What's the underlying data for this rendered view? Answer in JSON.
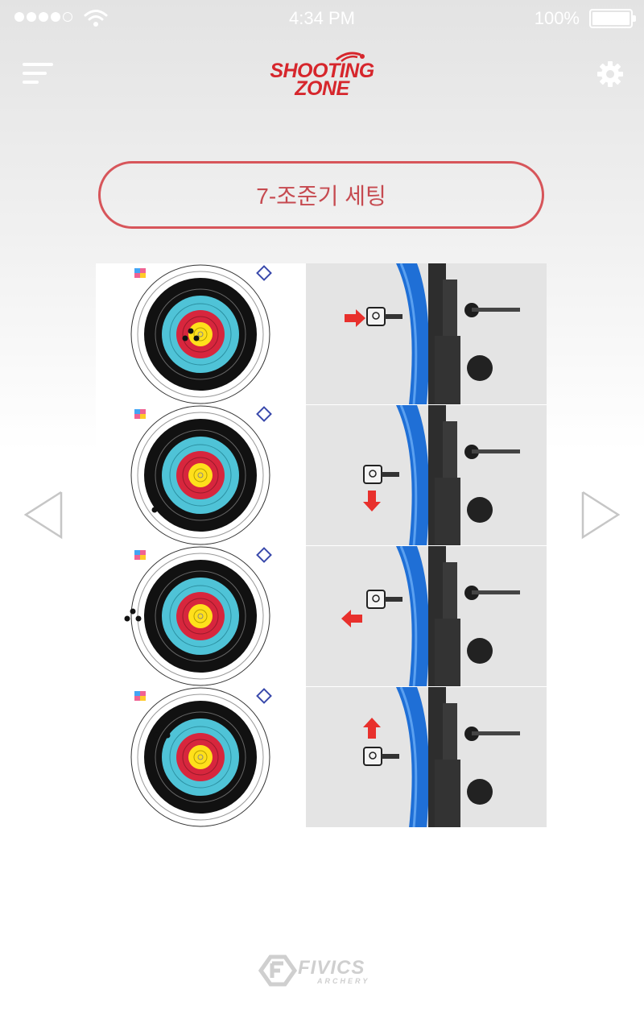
{
  "status_bar": {
    "time": "4:34 PM",
    "battery_percent": "100%",
    "signal_bars_filled": 4,
    "signal_bars_total": 5
  },
  "header": {
    "app_logo_line1": "SHOOTING",
    "app_logo_line2": "ZONE",
    "menu_icon": "menu-icon",
    "settings_icon": "gear-icon"
  },
  "page": {
    "title": "7-조준기 세팅"
  },
  "steps": [
    {
      "target_group": "right",
      "arrow": "right"
    },
    {
      "target_group": "bottom",
      "arrow": "down"
    },
    {
      "target_group": "left",
      "arrow": "left"
    },
    {
      "target_group": "top",
      "arrow": "up"
    }
  ],
  "navigation": {
    "prev_icon": "chevron-left-icon",
    "next_icon": "chevron-right-icon"
  },
  "footer": {
    "brand": "FIVICS",
    "brand_sub": "ARCHERY"
  },
  "colors": {
    "accent": "#d7555a",
    "brand_red": "#d6262c",
    "bow_blue": "#1f6fd6",
    "arrow_red": "#e8302c"
  }
}
